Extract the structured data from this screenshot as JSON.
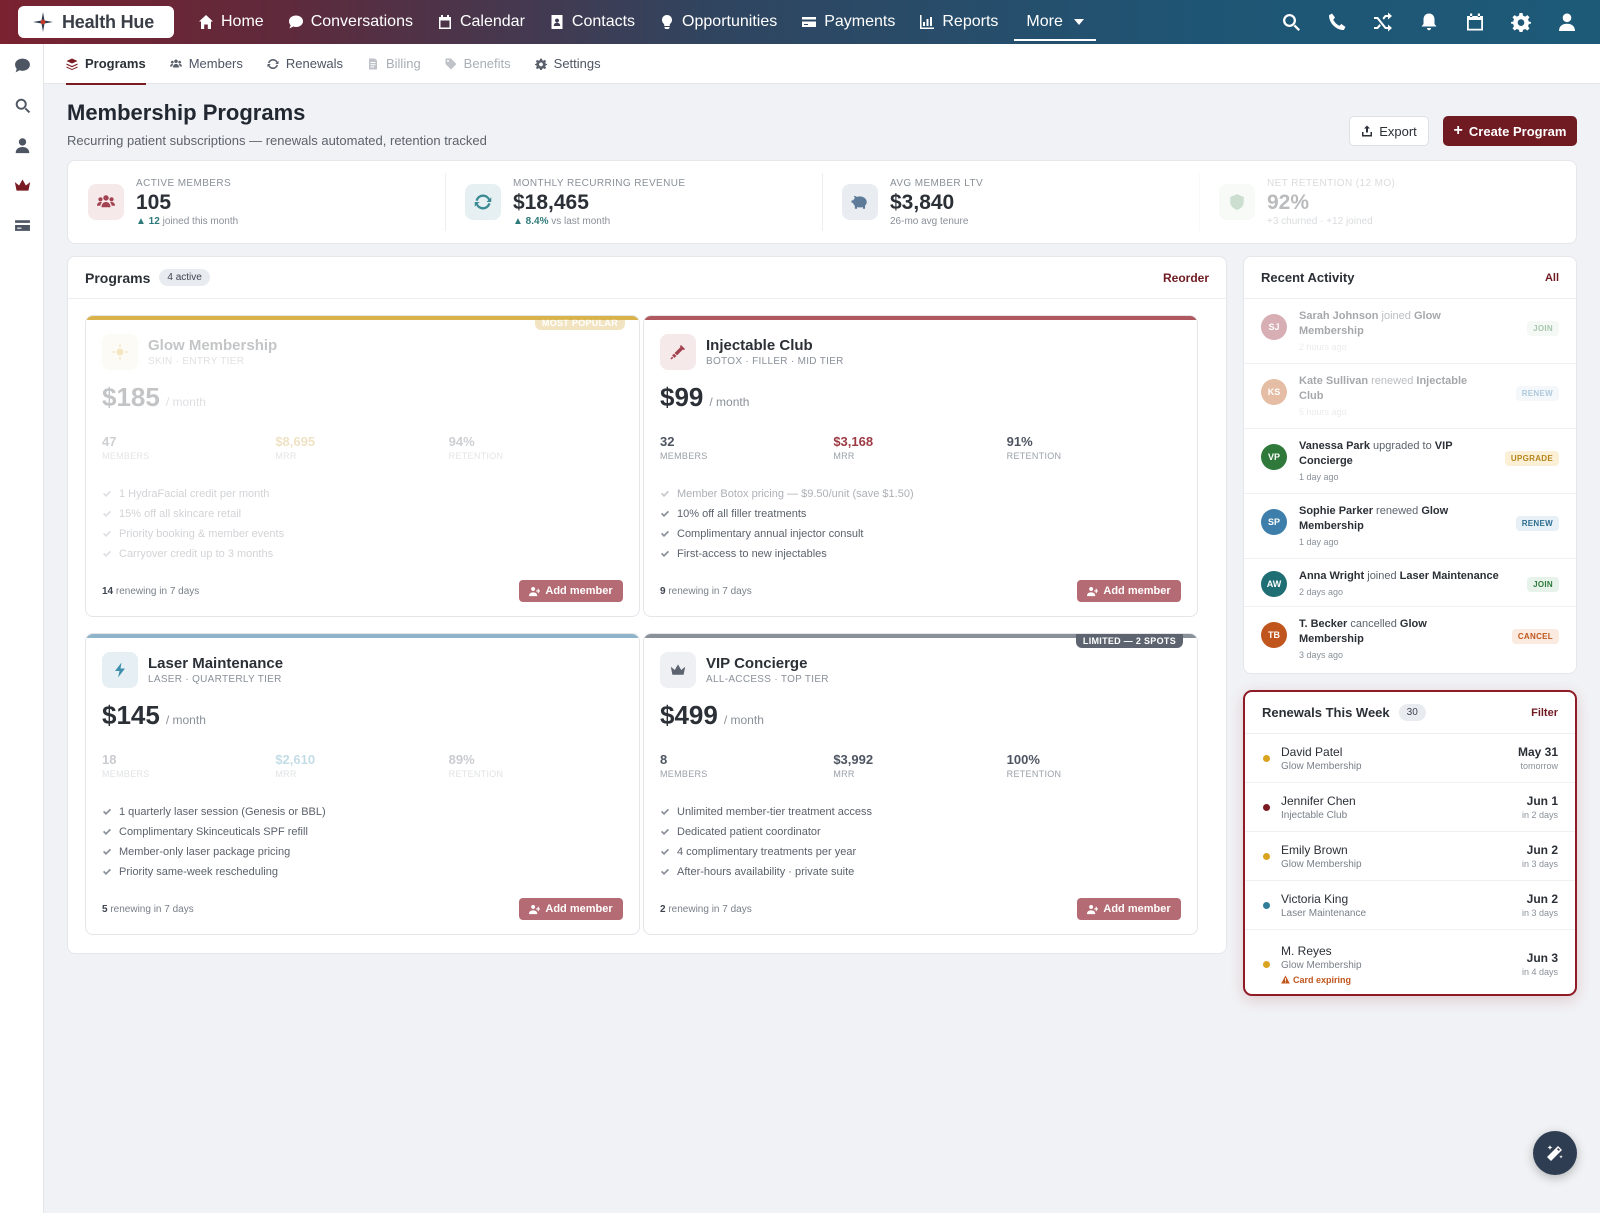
{
  "brand": {
    "name": "Health Hue"
  },
  "topnav": {
    "items": [
      {
        "label": "Home",
        "icon": "home-icon"
      },
      {
        "label": "Conversations",
        "icon": "chat-icon"
      },
      {
        "label": "Calendar",
        "icon": "calendar-icon"
      },
      {
        "label": "Contacts",
        "icon": "contacts-icon"
      },
      {
        "label": "Opportunities",
        "icon": "lightbulb-icon"
      },
      {
        "label": "Payments",
        "icon": "credit-card-icon"
      },
      {
        "label": "Reports",
        "icon": "bar-chart-icon"
      }
    ],
    "more_label": "More",
    "right_icons": [
      "search-icon",
      "phone-icon",
      "shuffle-icon",
      "bell-icon",
      "calendar-icon",
      "gear-icon",
      "user-icon"
    ]
  },
  "leftrail": {
    "icons": [
      "chat-icon",
      "search-icon",
      "user-icon",
      "crown-icon",
      "card-icon"
    ]
  },
  "subnav": {
    "tabs": [
      {
        "label": "Programs",
        "icon": "layers-icon",
        "state": "active"
      },
      {
        "label": "Members",
        "icon": "users-icon",
        "state": "normal"
      },
      {
        "label": "Renewals",
        "icon": "refresh-icon",
        "state": "normal"
      },
      {
        "label": "Billing",
        "icon": "document-icon",
        "state": "disabled"
      },
      {
        "label": "Benefits",
        "icon": "tag-icon",
        "state": "disabled"
      },
      {
        "label": "Settings",
        "icon": "gear-icon",
        "state": "normal"
      }
    ]
  },
  "header": {
    "title": "Membership Programs",
    "subtitle": "Recurring patient subscriptions — renewals automated, retention tracked",
    "export_label": "Export",
    "create_label": "Create Program"
  },
  "stats": [
    {
      "label": "ACTIVE MEMBERS",
      "value": "105",
      "delta": "▲ 12",
      "sub": "joined this month",
      "icon": "users-icon"
    },
    {
      "label": "MONTHLY RECURRING REVENUE",
      "value": "$18,465",
      "delta": "▲ 8.4%",
      "sub": "vs last month",
      "icon": "refresh-icon"
    },
    {
      "label": "AVG MEMBER LTV",
      "value": "$3,840",
      "delta": "",
      "sub": "26-mo avg tenure",
      "icon": "piggy-bank-icon"
    },
    {
      "label": "NET RETENTION (12 MO)",
      "value": "92%",
      "delta": "",
      "sub": "+3 churned · +12 joined",
      "icon": "shield-icon"
    }
  ],
  "programs": {
    "title": "Programs",
    "badge": "4 active",
    "reorder_label": "Reorder",
    "members_label": "MEMBERS",
    "mrr_label": "MRR",
    "retention_label": "RETENTION",
    "add_label": "Add member",
    "items": [
      {
        "name": "Glow Membership",
        "tier": "SKIN · ENTRY TIER",
        "price": "$185",
        "per": "/ month",
        "members": "47",
        "mrr": "$8,695",
        "retention": "94%",
        "ribbon": "MOST POPULAR",
        "features": [
          "1 HydraFacial credit per month",
          "15% off all skincare retail",
          "Priority booking & member events",
          "Carryover credit up to 3 months"
        ],
        "renew_count": "14",
        "renew_text": "renewing in 7 days",
        "accent": "#d9b24a"
      },
      {
        "name": "Injectable Club",
        "tier": "BOTOX · FILLER · MID TIER",
        "price": "$99",
        "per": "/ month",
        "members": "32",
        "mrr": "$3,168",
        "retention": "91%",
        "ribbon": "",
        "features": [
          "Member Botox pricing — $9.50/unit (save $1.50)",
          "10% off all filler treatments",
          "Complimentary annual injector consult",
          "First-access to new injectables"
        ],
        "renew_count": "9",
        "renew_text": "renewing in 7 days",
        "accent": "#b0585f"
      },
      {
        "name": "Laser Maintenance",
        "tier": "LASER · QUARTERLY TIER",
        "price": "$145",
        "per": "/ month",
        "members": "18",
        "mrr": "$2,610",
        "retention": "89%",
        "ribbon": "",
        "features": [
          "1 quarterly laser session (Genesis or BBL)",
          "Complimentary Skinceuticals SPF refill",
          "Member-only laser package pricing",
          "Priority same-week rescheduling"
        ],
        "renew_count": "5",
        "renew_text": "renewing in 7 days",
        "accent": "#4f86a8"
      },
      {
        "name": "VIP Concierge",
        "tier": "ALL-ACCESS · TOP TIER",
        "price": "$499",
        "per": "/ month",
        "members": "8",
        "mrr": "$3,992",
        "retention": "100%",
        "ribbon": "LIMITED — 2 SPOTS",
        "features": [
          "Unlimited member-tier treatment access",
          "Dedicated patient coordinator",
          "4 complimentary treatments per year",
          "After-hours availability · private suite"
        ],
        "renew_count": "2",
        "renew_text": "renewing in 7 days",
        "accent": "#5d6470"
      }
    ]
  },
  "activity": {
    "title": "Recent Activity",
    "all_label": "All",
    "items": [
      {
        "initials": "SJ",
        "name": "Sarah Johnson",
        "verb": "joined",
        "target": "Glow Membership",
        "time": "2 hours ago",
        "badge": "JOIN",
        "color": "#a2414f"
      },
      {
        "initials": "KS",
        "name": "Kate Sullivan",
        "verb": "renewed",
        "target": "Injectable Club",
        "time": "5 hours ago",
        "badge": "RENEW",
        "color": "#c2632a"
      },
      {
        "initials": "VP",
        "name": "Vanessa Park",
        "verb": "upgraded to",
        "target": "VIP Concierge",
        "time": "1 day ago",
        "badge": "UPGRADE",
        "color": "#2f7a3a"
      },
      {
        "initials": "SP",
        "name": "Sophie Parker",
        "verb": "renewed",
        "target": "Glow Membership",
        "time": "1 day ago",
        "badge": "RENEW",
        "color": "#3d7eab"
      },
      {
        "initials": "AW",
        "name": "Anna Wright",
        "verb": "joined",
        "target": "Laser Maintenance",
        "time": "2 days ago",
        "badge": "JOIN",
        "color": "#1f6e74"
      },
      {
        "initials": "TB",
        "name": "T. Becker",
        "verb": "cancelled",
        "target": "Glow Membership",
        "time": "3 days ago",
        "badge": "CANCEL",
        "color": "#c0561e"
      }
    ]
  },
  "renewals": {
    "title": "Renewals This Week",
    "count": "30",
    "filter_label": "Filter",
    "items": [
      {
        "name": "David Patel",
        "program": "Glow Membership",
        "date": "May 31",
        "rel": "tomorrow",
        "dot": "#d9a21f",
        "warning": ""
      },
      {
        "name": "Jennifer Chen",
        "program": "Injectable Club",
        "date": "Jun 1",
        "rel": "in 2 days",
        "dot": "#7a1a22",
        "warning": ""
      },
      {
        "name": "Emily Brown",
        "program": "Glow Membership",
        "date": "Jun 2",
        "rel": "in 3 days",
        "dot": "#d9a21f",
        "warning": ""
      },
      {
        "name": "Victoria King",
        "program": "Laser Maintenance",
        "date": "Jun 2",
        "rel": "in 3 days",
        "dot": "#2f7d98",
        "warning": ""
      },
      {
        "name": "M. Reyes",
        "program": "Glow Membership",
        "date": "Jun 3",
        "rel": "in 4 days",
        "dot": "#d9a21f",
        "warning": "Card expiring"
      }
    ]
  },
  "fab": {
    "icon": "magic-wand-icon"
  }
}
